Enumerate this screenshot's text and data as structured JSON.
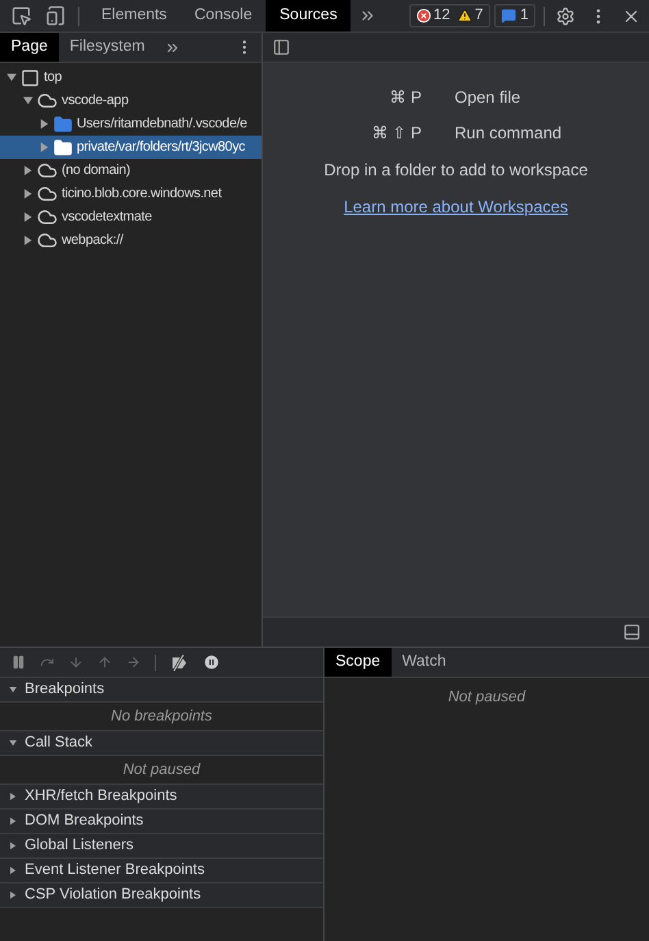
{
  "toolbar": {
    "tabs": [
      {
        "label": "Elements",
        "selected": false
      },
      {
        "label": "Console",
        "selected": false
      },
      {
        "label": "Sources",
        "selected": true
      }
    ],
    "errors": "12",
    "warnings": "7",
    "messages": "1"
  },
  "navigator": {
    "tabs": [
      {
        "label": "Page",
        "selected": true
      },
      {
        "label": "Filesystem",
        "selected": false
      }
    ],
    "tree": [
      {
        "label": "top",
        "kind": "frame",
        "expanded": true,
        "selected": false,
        "children": [
          {
            "label": "vscode-app",
            "kind": "domain",
            "expanded": true,
            "selected": false,
            "children": [
              {
                "label": "Users/ritamdebnath/.vscode/e",
                "kind": "folder",
                "expanded": false,
                "selected": false
              },
              {
                "label": "private/var/folders/rt/3jcw80yc",
                "kind": "folder",
                "expanded": false,
                "selected": true
              }
            ]
          },
          {
            "label": "(no domain)",
            "kind": "domain",
            "expanded": false,
            "selected": false
          },
          {
            "label": "ticino.blob.core.windows.net",
            "kind": "domain",
            "expanded": false,
            "selected": false
          },
          {
            "label": "vscodetextmate",
            "kind": "domain",
            "expanded": false,
            "selected": false
          },
          {
            "label": "webpack://",
            "kind": "domain",
            "expanded": false,
            "selected": false
          }
        ]
      }
    ]
  },
  "editor": {
    "shortcuts": [
      {
        "keys": "⌘ P",
        "label": "Open file"
      },
      {
        "keys": "⌘ ⇧ P",
        "label": "Run command"
      }
    ],
    "hint": "Drop in a folder to add to workspace",
    "link": "Learn more about Workspaces"
  },
  "debugger": {
    "sections": [
      {
        "title": "Breakpoints",
        "expanded": true,
        "message": "No breakpoints"
      },
      {
        "title": "Call Stack",
        "expanded": true,
        "message": "Not paused"
      },
      {
        "title": "XHR/fetch Breakpoints",
        "expanded": false
      },
      {
        "title": "DOM Breakpoints",
        "expanded": false
      },
      {
        "title": "Global Listeners",
        "expanded": false
      },
      {
        "title": "Event Listener Breakpoints",
        "expanded": false
      },
      {
        "title": "CSP Violation Breakpoints",
        "expanded": false
      }
    ]
  },
  "sidebar": {
    "tabs": [
      {
        "label": "Scope",
        "selected": true
      },
      {
        "label": "Watch",
        "selected": false
      }
    ],
    "message": "Not paused"
  }
}
